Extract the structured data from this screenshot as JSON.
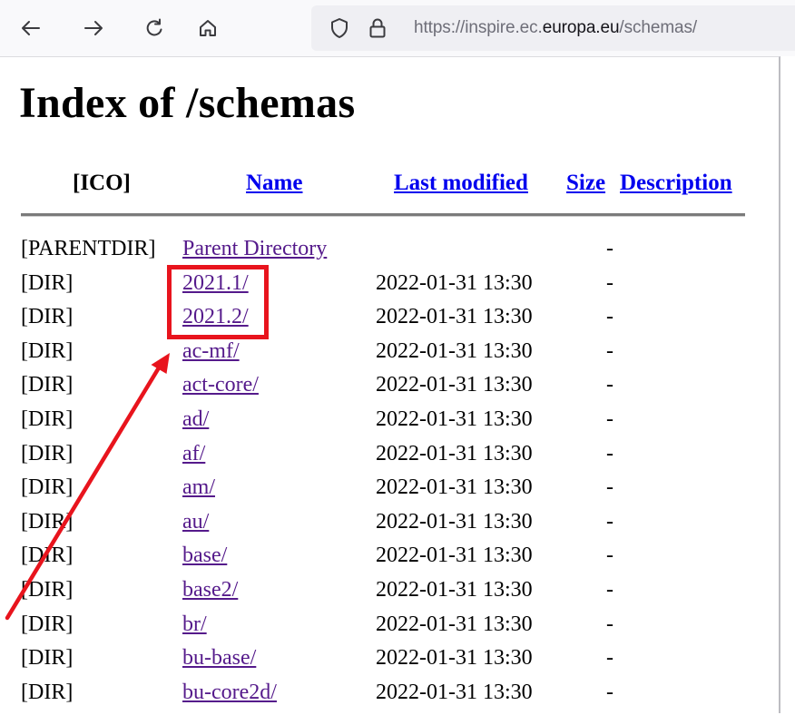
{
  "browser": {
    "url_prefix": "https://inspire.ec.",
    "url_domain": "europa.eu",
    "url_suffix": "/schemas/"
  },
  "page": {
    "title": "Index of /schemas",
    "columns": {
      "icon": "[ICO]",
      "name": "Name",
      "last_modified": "Last modified",
      "size": "Size",
      "description": "Description"
    },
    "rows": [
      {
        "icon": "[PARENTDIR]",
        "name": "Parent Directory",
        "modified": "",
        "size": "-"
      },
      {
        "icon": "[DIR]",
        "name": "2021.1/",
        "modified": "2022-01-31 13:30",
        "size": "-"
      },
      {
        "icon": "[DIR]",
        "name": "2021.2/",
        "modified": "2022-01-31 13:30",
        "size": "-"
      },
      {
        "icon": "[DIR]",
        "name": "ac-mf/",
        "modified": "2022-01-31 13:30",
        "size": "-"
      },
      {
        "icon": "[DIR]",
        "name": "act-core/",
        "modified": "2022-01-31 13:30",
        "size": "-"
      },
      {
        "icon": "[DIR]",
        "name": "ad/",
        "modified": "2022-01-31 13:30",
        "size": "-"
      },
      {
        "icon": "[DIR]",
        "name": "af/",
        "modified": "2022-01-31 13:30",
        "size": "-"
      },
      {
        "icon": "[DIR]",
        "name": "am/",
        "modified": "2022-01-31 13:30",
        "size": "-"
      },
      {
        "icon": "[DIR]",
        "name": "au/",
        "modified": "2022-01-31 13:30",
        "size": "-"
      },
      {
        "icon": "[DIR]",
        "name": "base/",
        "modified": "2022-01-31 13:30",
        "size": "-"
      },
      {
        "icon": "[DIR]",
        "name": "base2/",
        "modified": "2022-01-31 13:30",
        "size": "-"
      },
      {
        "icon": "[DIR]",
        "name": "br/",
        "modified": "2022-01-31 13:30",
        "size": "-"
      },
      {
        "icon": "[DIR]",
        "name": "bu-base/",
        "modified": "2022-01-31 13:30",
        "size": "-"
      },
      {
        "icon": "[DIR]",
        "name": "bu-core2d/",
        "modified": "2022-01-31 13:30",
        "size": "-"
      }
    ]
  },
  "colors": {
    "link": "#0000ee",
    "visited_link": "#551a8b",
    "annotation": "#e8141d"
  },
  "icons": {
    "back": "arrow-left-icon",
    "forward": "arrow-right-icon",
    "reload": "reload-icon",
    "home": "home-icon",
    "tracking": "shield-icon",
    "security": "lock-icon"
  }
}
